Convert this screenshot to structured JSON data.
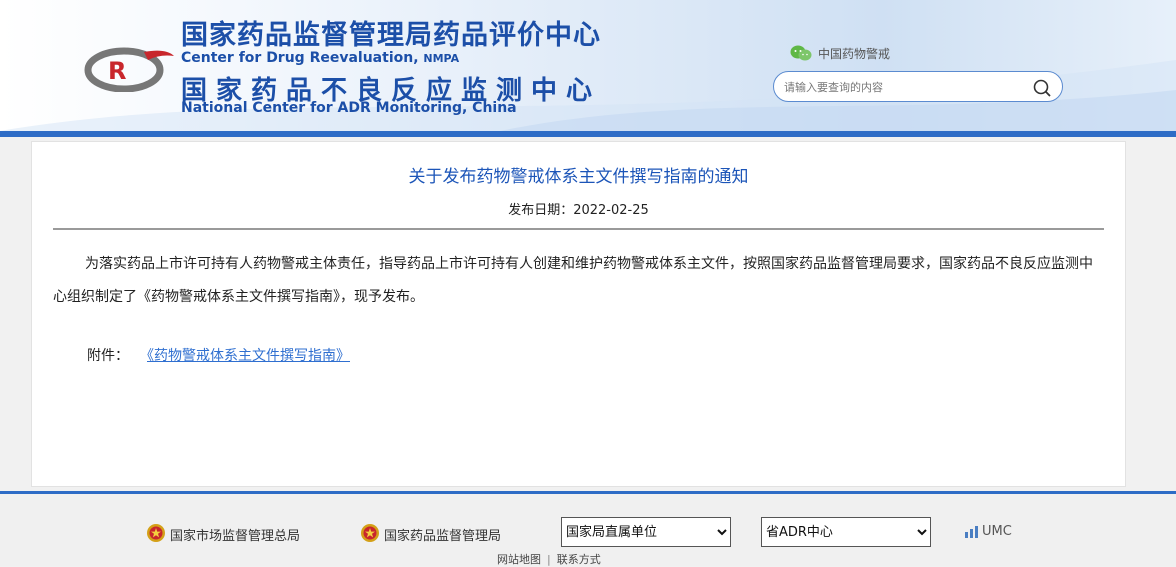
{
  "header": {
    "title_cn_main": "国家药品监督管理局药品评价中心",
    "title_en_main": "Center for Drug Reevaluation,",
    "title_en_suffix": "NMPA",
    "title_cn_sub": "国家药品不良反应监测中心",
    "title_en_sub": "National Center for ADR Monitoring, China",
    "wechat_label": "中国药物警戒",
    "search": {
      "placeholder": "请输入要查询的内容"
    }
  },
  "article": {
    "title": "关于发布药物警戒体系主文件撰写指南的通知",
    "date_label": "发布日期：",
    "date": "2022-02-25",
    "body": "为落实药品上市许可持有人药物警戒主体责任，指导药品上市许可持有人创建和维护药物警戒体系主文件，按照国家药品监督管理局要求，国家药品不良反应监测中心组织制定了《药物警戒体系主文件撰写指南》，现予发布。",
    "attachment_label": "附件：",
    "attachment_link": "《药物警戒体系主文件撰写指南》"
  },
  "footer": {
    "link1": "国家市场监督管理总局",
    "link2": "国家药品监督管理局",
    "select1": "国家局直属单位",
    "select2": "省ADR中心",
    "umc": "UMC",
    "sitemap": "网站地图",
    "divider": "|",
    "contact": "联系方式"
  },
  "colors": {
    "brand_blue": "#1c4fa8",
    "bar_blue": "#2e6cc6",
    "link_blue": "#2f6fd0"
  }
}
